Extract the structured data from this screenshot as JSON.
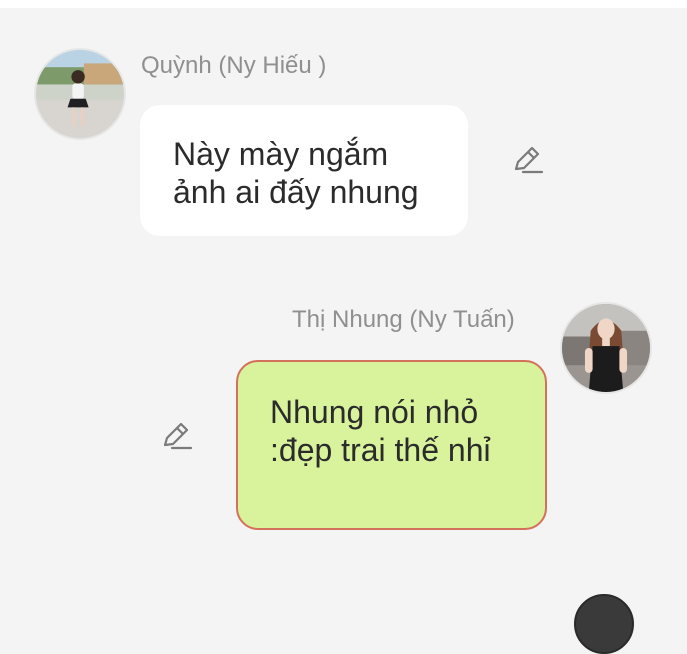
{
  "messages": [
    {
      "sender": "Quỳnh (Ny Hiếu )",
      "text": "Này mày ngắm ảnh ai đấy nhung",
      "direction": "incoming",
      "bubble_color": "#ffffff"
    },
    {
      "sender": "Thị Nhung (Ny Tuấn)",
      "text": "Nhung nói nhỏ :đẹp trai thế nhỉ",
      "direction": "outgoing",
      "bubble_color": "#d9f29c",
      "border_color": "#d4715a"
    }
  ],
  "icons": {
    "edit": "pencil-icon"
  },
  "colors": {
    "background": "#f4f4f4",
    "sender_text": "#8f8f8f",
    "message_text": "#2b2b2b"
  }
}
